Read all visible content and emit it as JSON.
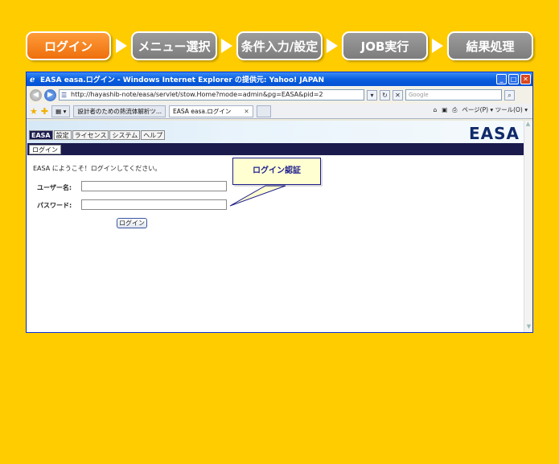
{
  "steps": [
    "ログイン",
    "メニュー選択",
    "条件入力/設定",
    "JOB実行",
    "結果処理"
  ],
  "browser": {
    "title": "EASA easa.ログイン - Windows Internet Explorer の提供元: Yahoo! JAPAN",
    "url": "http://hayashib-note/easa/servlet/stow.Home?mode=admin&pg=EASA&pid=2",
    "search_placeholder": "Google",
    "tabs": [
      "設計者のための熱流体解析ツ...",
      "EASA easa.ログイン"
    ],
    "tools": "ページ(P) ▾  ツール(O) ▾"
  },
  "app": {
    "logo": "EASA",
    "menu": [
      "EASA",
      "設定",
      "ライセンス",
      "システム",
      "ヘルプ"
    ],
    "submenu": "ログイン",
    "welcome": "EASA にようこそ！ログインしてください。",
    "username_label": "ユーザー名:",
    "password_label": "パスワード:",
    "login_button": "ログイン"
  },
  "callout": "ログイン認証"
}
